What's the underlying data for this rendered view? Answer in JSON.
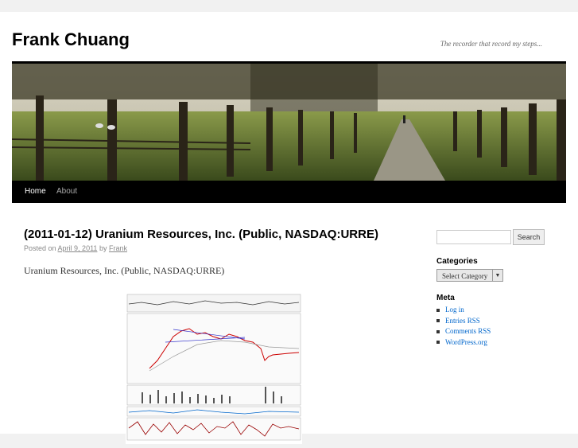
{
  "site": {
    "title": "Frank Chuang",
    "description": "The recorder that record my steps..."
  },
  "nav": {
    "items": [
      {
        "label": "Home",
        "active": true
      },
      {
        "label": "About",
        "active": false
      }
    ]
  },
  "post": {
    "title": "(2011-01-12) Uranium Resources, Inc. (Public, NASDAQ:URRE)",
    "posted_on_label": "Posted on",
    "date": "April 9, 2011",
    "by_label": "by",
    "author": "Frank",
    "excerpt": "Uranium Resources, Inc. (Public, NASDAQ:URRE)"
  },
  "sidebar": {
    "search_button": "Search",
    "search_placeholder": "",
    "categories_title": "Categories",
    "categories_select": "Select Category",
    "meta_title": "Meta",
    "meta_links": [
      "Log in",
      "Entries RSS",
      "Comments RSS",
      "WordPress.org"
    ]
  },
  "colors": {
    "nav_bg": "#000000",
    "link": "#0066cc"
  }
}
